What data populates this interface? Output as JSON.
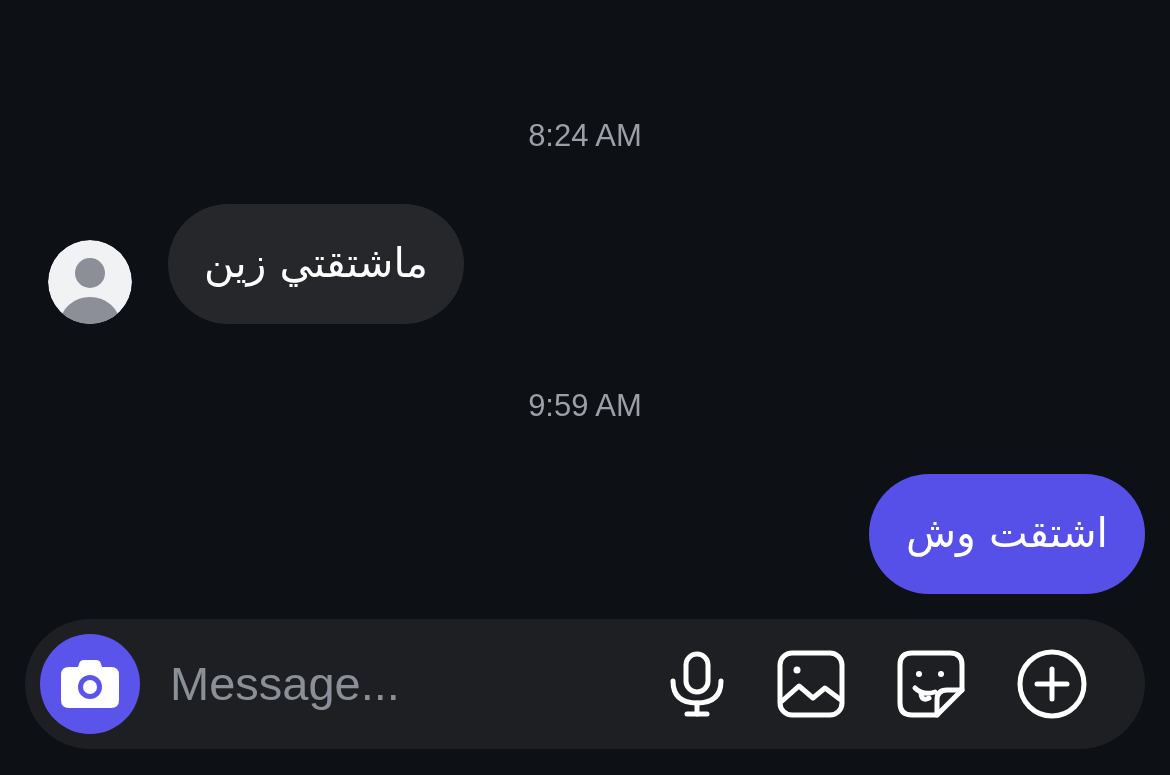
{
  "messages": [
    {
      "kind": "timestamp",
      "text": "8:24 AM"
    },
    {
      "kind": "incoming",
      "text": "ماشتقتي زين"
    },
    {
      "kind": "timestamp",
      "text": "9:59 AM"
    },
    {
      "kind": "outgoing",
      "text": "اشتقت وش"
    }
  ],
  "composer": {
    "placeholder": "Message..."
  }
}
